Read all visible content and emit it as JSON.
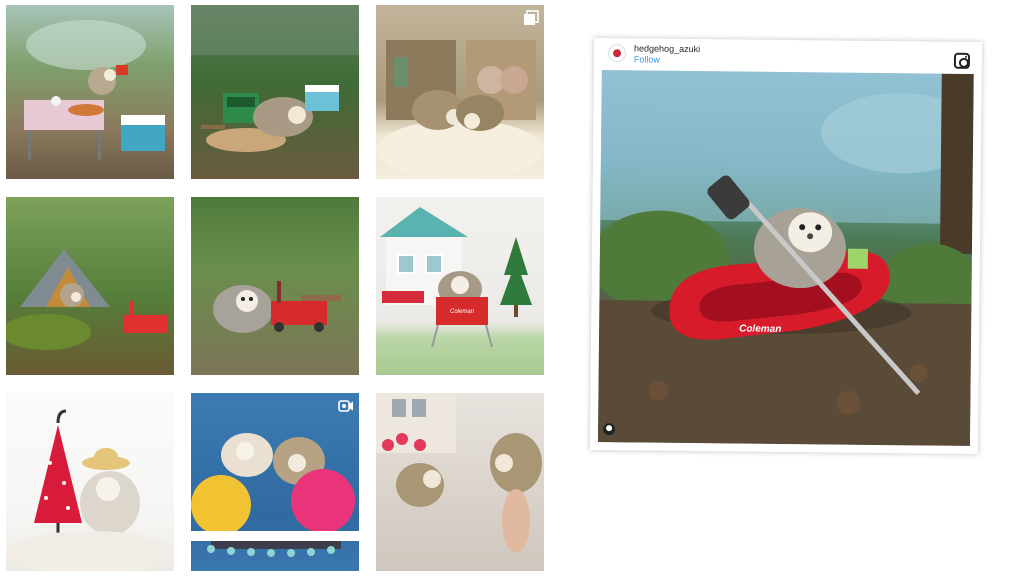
{
  "grid": {
    "tiles": [
      {
        "id": "t1",
        "subject": "picnic-table-scene",
        "badge": ""
      },
      {
        "id": "t2",
        "subject": "camping-stove-scene",
        "badge": ""
      },
      {
        "id": "t3",
        "subject": "two-hedgehogs-rug-scene",
        "badge": "multi-photo-icon"
      },
      {
        "id": "t4",
        "subject": "tent-scene",
        "badge": ""
      },
      {
        "id": "t5",
        "subject": "wagon-scene",
        "badge": ""
      },
      {
        "id": "t6",
        "subject": "dollhouse-chair-scene",
        "badge": ""
      },
      {
        "id": "t7",
        "subject": "umbrella-hat-scene",
        "badge": ""
      },
      {
        "id": "t8",
        "subject": "pom-pom-bed-scene",
        "badge": "video-icon"
      },
      {
        "id": "t9",
        "subject": "mirror-reflection-scene",
        "badge": ""
      }
    ]
  },
  "embed": {
    "username": "hedgehog_azuki",
    "follow_label": "Follow",
    "brand_icon": "instagram-icon",
    "photo_subject": "kayak-hedgehog",
    "kayak_text": "Coleman",
    "tagged_icon": "person-tag-icon"
  },
  "colors": {
    "follow_link": "#3897f0",
    "kayak_red": "#d81b2b"
  }
}
